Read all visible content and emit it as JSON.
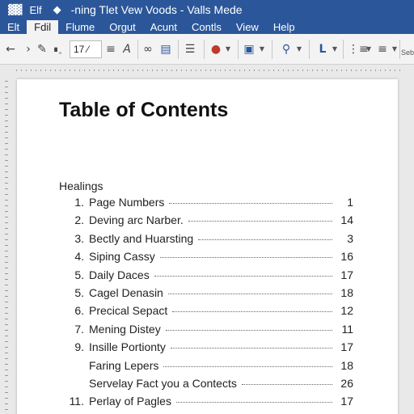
{
  "titlebar": {
    "file_label": "Elf",
    "title": "-ning  Tlet  Vew  Voods - Valls Mede",
    "bg_color": "#2b579a"
  },
  "menu": [
    {
      "label": "Elt",
      "active": false
    },
    {
      "label": "Fdil",
      "active": true
    },
    {
      "label": "Flume",
      "active": false
    },
    {
      "label": "Orgut",
      "active": false
    },
    {
      "label": "Acunt",
      "active": false
    },
    {
      "label": "Contls",
      "active": false
    },
    {
      "label": "View",
      "active": false
    },
    {
      "label": "Help",
      "active": false
    }
  ],
  "toolbar": {
    "page_value": "17",
    "side_label": "Seb"
  },
  "document": {
    "title": "Table of Contents",
    "heading": "Healings",
    "entries": [
      {
        "num": "1.",
        "text": "Page Numbers",
        "page": "1"
      },
      {
        "num": "2.",
        "text": "Deving arc Narber.",
        "page": "14"
      },
      {
        "num": "3.",
        "text": "Bectly and Huarsting",
        "page": "3"
      },
      {
        "num": "4.",
        "text": "Siping Cassy",
        "page": "16"
      },
      {
        "num": "5.",
        "text": "Daily Daces",
        "page": "17"
      },
      {
        "num": "5.",
        "text": "Cagel Denasin",
        "page": "18"
      },
      {
        "num": "6.",
        "text": "Precical Sepact",
        "page": "12"
      },
      {
        "num": "7.",
        "text": "Mening Distey",
        "page": "11"
      },
      {
        "num": "9.",
        "text": "Insille Portionty",
        "page": "17"
      },
      {
        "num": "",
        "text": "Faring Lepers",
        "page": "18"
      },
      {
        "num": "",
        "text": "Servelay Fact you a Contects",
        "page": "26"
      },
      {
        "num": "11.",
        "text": "Perlay of Pagles",
        "page": "17"
      }
    ]
  }
}
